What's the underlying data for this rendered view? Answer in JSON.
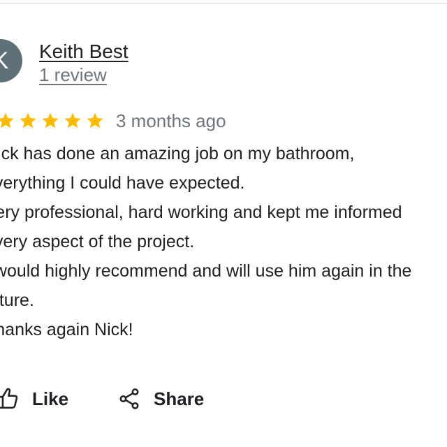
{
  "review": {
    "avatar_letter": "K",
    "reviewer_name": "Keith Best",
    "review_count": "1 review",
    "rating": 5,
    "rating_max": 5,
    "star_color": "#fbbc04",
    "date": "3 months ago",
    "body_lines": [
      "Nick has done an amazing job on my bathroom,",
      "everything I could have expected.",
      "Very professional, hard working and kept me informed",
      "every aspect of the project.",
      "I would highly recommend and will use him again in the",
      "future.",
      "Thanks again Nick!"
    ]
  },
  "actions": {
    "like_label": "Like",
    "like_icon": "thumbs-up-icon",
    "share_label": "Share",
    "share_icon": "share-icon"
  }
}
